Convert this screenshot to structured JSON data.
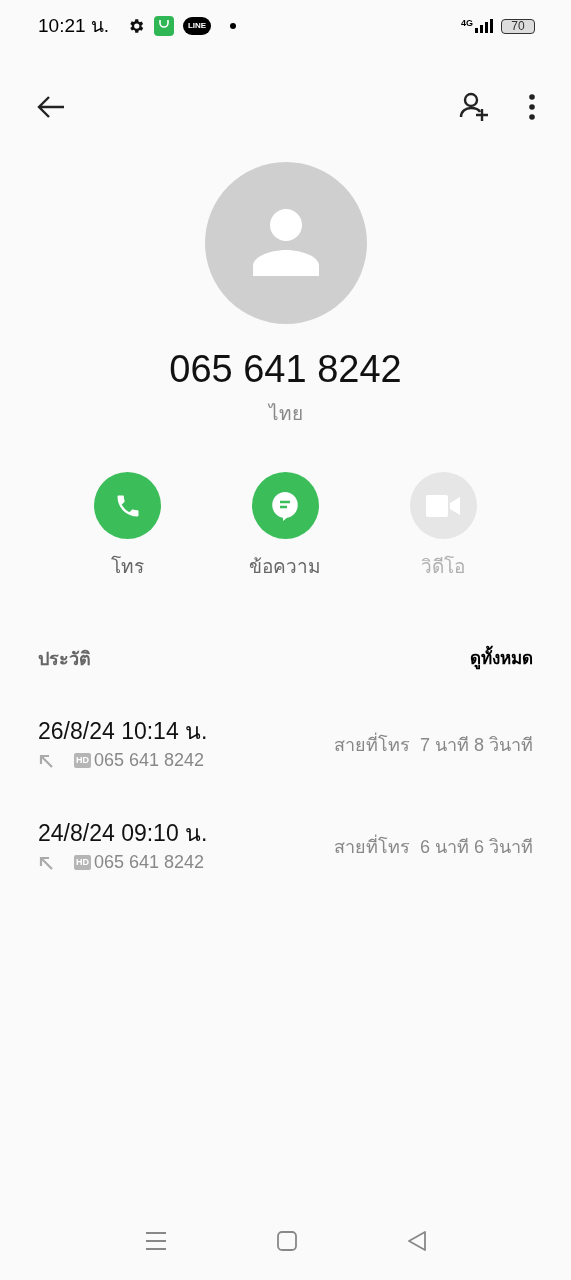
{
  "status_bar": {
    "time": "10:21 น.",
    "network": "4G",
    "battery": "70",
    "app_badge": "LINE"
  },
  "contact": {
    "number": "065 641 8242",
    "location": "ไทย"
  },
  "actions": [
    {
      "kind": "call",
      "label": "โทร",
      "disabled": false
    },
    {
      "kind": "message",
      "label": "ข้อความ",
      "disabled": false
    },
    {
      "kind": "video",
      "label": "วิดีโอ",
      "disabled": true
    }
  ],
  "history": {
    "title": "ประวัติ",
    "view_all": "ดูทั้งหมด",
    "calls": [
      {
        "datetime": "26/8/24 10:14 น.",
        "hd": "HD",
        "number": "065 641 8242",
        "duration": "สายที่โทร  7 นาที 8 วินาที"
      },
      {
        "datetime": "24/8/24 09:10 น.",
        "hd": "HD",
        "number": "065 641 8242",
        "duration": "สายที่โทร  6 นาที 6 วินาที"
      }
    ]
  }
}
